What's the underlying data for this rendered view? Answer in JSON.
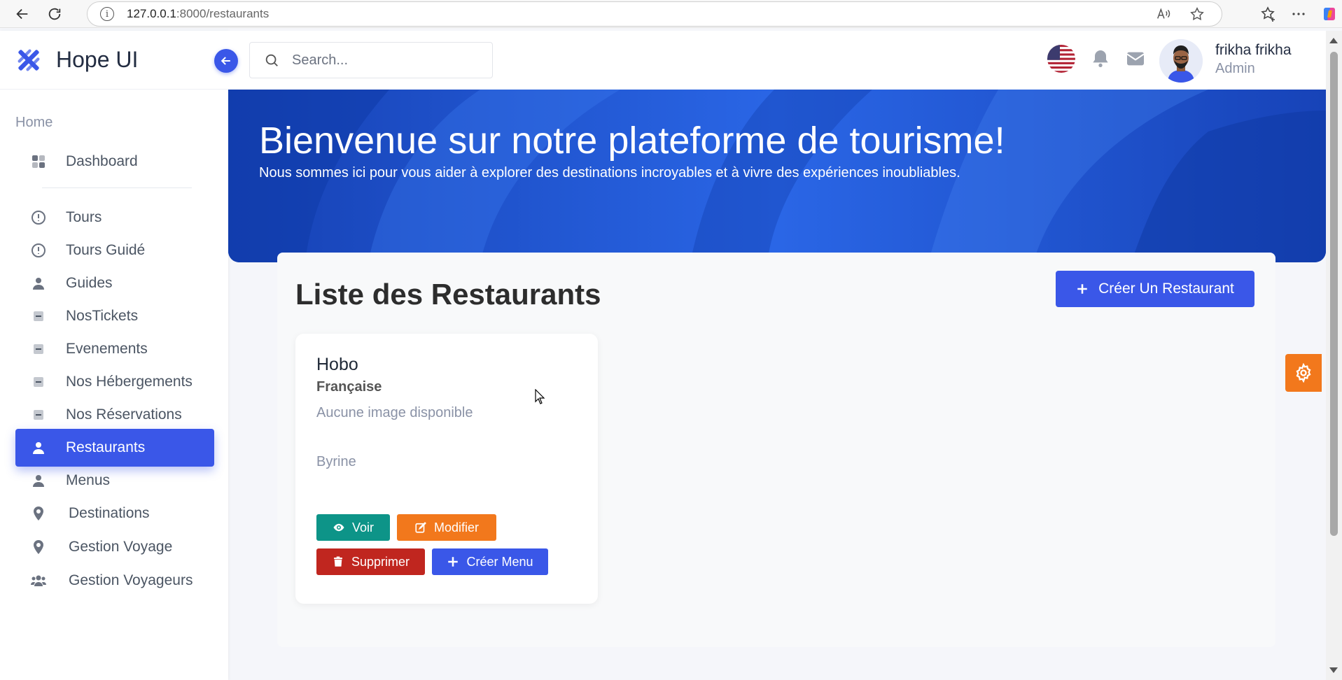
{
  "browser": {
    "url_host": "127.0.0.1",
    "url_path": ":8000/restaurants"
  },
  "sidebar": {
    "brand": "Hope UI",
    "section_label": "Home",
    "items": [
      {
        "label": "Dashboard",
        "icon": "dashboard-icon"
      },
      {
        "label": "Tours",
        "icon": "alert-circle-icon"
      },
      {
        "label": "Tours Guidé",
        "icon": "alert-circle-icon"
      },
      {
        "label": "Guides",
        "icon": "user-icon"
      },
      {
        "label": "NosTickets",
        "icon": "minus-square-icon"
      },
      {
        "label": "Evenements",
        "icon": "minus-square-icon"
      },
      {
        "label": "Nos Hébergements",
        "icon": "minus-square-icon"
      },
      {
        "label": "Nos Réservations",
        "icon": "minus-square-icon"
      },
      {
        "label": "Restaurants",
        "icon": "user-icon",
        "active": true
      },
      {
        "label": "Menus",
        "icon": "user-icon"
      },
      {
        "label": "Destinations",
        "icon": "map-pin-icon"
      },
      {
        "label": "Gestion Voyage",
        "icon": "map-pin-icon"
      },
      {
        "label": "Gestion Voyageurs",
        "icon": "users-icon"
      }
    ]
  },
  "header": {
    "search_placeholder": "Search...",
    "user_name": "frikha frikha",
    "user_role": "Admin"
  },
  "banner": {
    "title": "Bienvenue sur notre plateforme de tourisme!",
    "subtitle": "Nous sommes ici pour vous aider à explorer des destinations incroyables et à vivre des expériences inoubliables."
  },
  "main": {
    "title": "Liste des Restaurants",
    "create_label": "Créer Un Restaurant",
    "restaurants": [
      {
        "name": "Hobo",
        "cuisine": "Française",
        "image_text": "Aucune image disponible",
        "location": "Byrine",
        "actions": {
          "view": "Voir",
          "edit": "Modifier",
          "delete": "Supprimer",
          "create_menu": "Créer Menu"
        }
      }
    ]
  },
  "colors": {
    "primary": "#3a57e8",
    "teal": "#0d9488",
    "orange": "#f2781c",
    "red": "#c0261f"
  }
}
